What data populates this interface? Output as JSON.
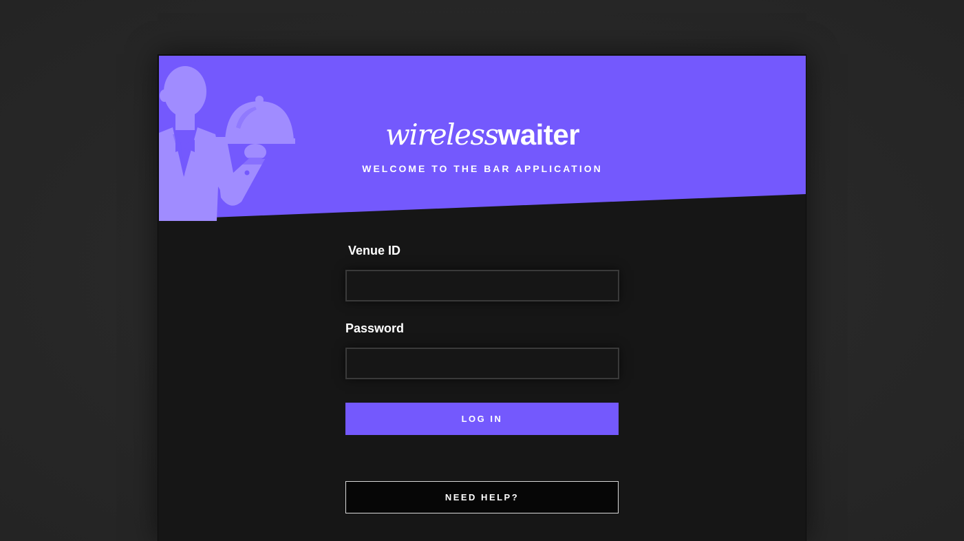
{
  "brand": {
    "logo_light": "wireless",
    "logo_bold": "waiter",
    "tagline": "WELCOME TO THE BAR APPLICATION"
  },
  "form": {
    "venue_label": "Venue ID",
    "venue_value": "",
    "password_label": "Password",
    "password_value": "",
    "login_label": "LOG IN",
    "help_label": "NEED HELP?"
  },
  "colors": {
    "accent": "#7459fd",
    "illustration": "#a08cff",
    "card_bg": "#161616",
    "page_bg": "#262626"
  },
  "icons": {
    "mascot": "waiter-with-cloche-icon"
  }
}
